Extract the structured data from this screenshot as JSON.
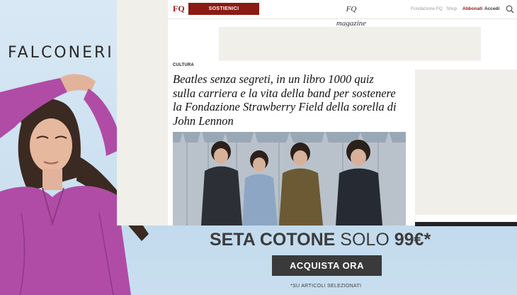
{
  "ad": {
    "brand": "FALCONERI",
    "headline_bold": "SETA COTONE",
    "headline_light": "SOLO",
    "headline_price": "99€*",
    "cta_label": "ACQUISTA ORA",
    "footnote": "*SU ARTICOLI SELEZIONATI",
    "colors": {
      "garment": "#b04ca6",
      "cta": "#3a3a3a",
      "sky": "#c4dbee"
    }
  },
  "header": {
    "logo_text": "FQ",
    "support_label": "SOSTIENICI",
    "magazine_logo": "FQ magazine",
    "nav": {
      "fondazione": "Fondazione FQ",
      "shop": "Shop",
      "abbonati": "Abbonati",
      "accedi": "Accedi"
    },
    "colors": {
      "accent": "#8b1a12"
    }
  },
  "article": {
    "category": "CULTURA",
    "headline": "Beatles senza segreti, in un libro 1000 quiz sulla carriera e la vita della band per sostenere la Fondazione Strawberry Field della sorella di John Lennon"
  },
  "icons": {
    "search": "search-icon"
  }
}
